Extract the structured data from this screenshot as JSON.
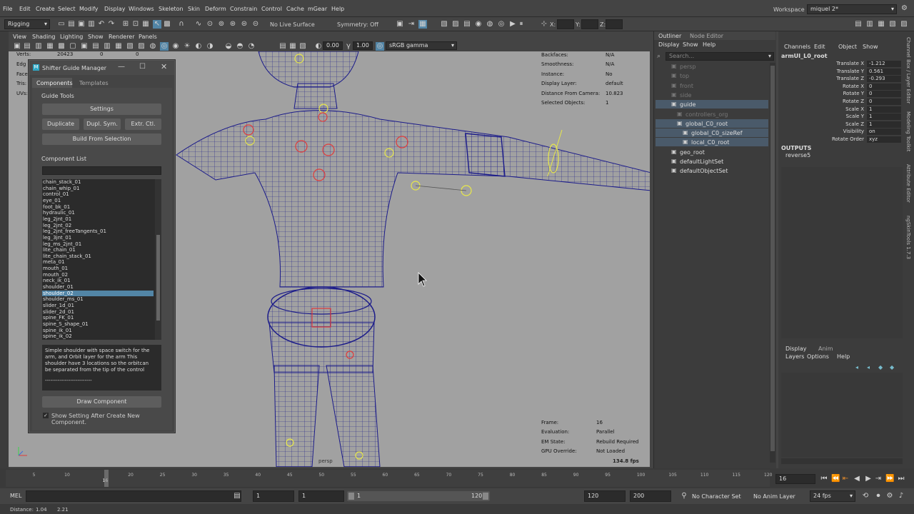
{
  "menubar": {
    "items": [
      "File",
      "Edit",
      "Create",
      "Select",
      "Modify",
      "Display",
      "Windows",
      "Skeleton",
      "Skin",
      "Deform",
      "Constrain",
      "Control",
      "Cache",
      "mGear",
      "Help"
    ],
    "workspace_label": "Workspace :",
    "workspace_value": "miquel 2*"
  },
  "shelf": {
    "mode": "Rigging",
    "live_surface": "No Live Surface",
    "symmetry": "Symmetry: Off",
    "x_label": "X:",
    "y_label": "Y:",
    "z_label": "Z:"
  },
  "viewport_menu": {
    "items": [
      "View",
      "Shading",
      "Lighting",
      "Show",
      "Renderer",
      "Panels"
    ],
    "val1": "0.00",
    "val2": "1.00",
    "colorspace": "sRGB gamma"
  },
  "stats": {
    "verts_label": "Verts:",
    "verts_val": "20423",
    "c2": "0",
    "c3": "0",
    "edges_label": "Edg",
    "faces_label": "Face",
    "tris_label": "Tris:",
    "uvs_label": "UVs:"
  },
  "hud_top": [
    {
      "label": "Backfaces:",
      "value": "N/A"
    },
    {
      "label": "Smoothness:",
      "value": "N/A"
    },
    {
      "label": "Instance:",
      "value": "No"
    },
    {
      "label": "Display Layer:",
      "value": "default"
    },
    {
      "label": "Distance From Camera:",
      "value": "10.823"
    },
    {
      "label": "Selected Objects:",
      "value": "1"
    }
  ],
  "hud_bottom": [
    {
      "label": "Frame:",
      "value": "16"
    },
    {
      "label": "Evaluation:",
      "value": "Parallel"
    },
    {
      "label": "EM State:",
      "value": "Rebuild Required"
    },
    {
      "label": "GPU Override:",
      "value": "Not Loaded"
    }
  ],
  "fps": "134.8 fps",
  "camera": "persp",
  "shifter": {
    "title": "Shifter Guide Manager",
    "tabs": [
      "Components",
      "Templates"
    ],
    "section": "Guide Tools",
    "settings": "Settings",
    "duplicate": "Duplicate",
    "dupl_sym": "Dupl. Sym.",
    "extr_ctl": "Extr. Ctl.",
    "build": "Build From Selection",
    "list_label": "Component List",
    "components": [
      "chain_stack_01",
      "chain_whip_01",
      "control_01",
      "eye_01",
      "foot_bk_01",
      "hydraulic_01",
      "leg_2jnt_01",
      "leg_2jnt_02",
      "leg_2jnt_freeTangents_01",
      "leg_3jnt_01",
      "leg_ms_2jnt_01",
      "lite_chain_01",
      "lite_chain_stack_01",
      "meta_01",
      "mouth_01",
      "mouth_02",
      "neck_ik_01",
      "shoulder_01",
      "shoulder_02",
      "shoulder_ms_01",
      "slider_1d_01",
      "slider_2d_01",
      "spine_FK_01",
      "spine_S_shape_01",
      "spine_ik_01",
      "spine_ik_02"
    ],
    "selected_index": 18,
    "description": "Simple shoulder with space switch for the arm, and Orbit layer for the arm This shoulder have 3 locations so the orbitcan be separated from the tip of the control",
    "desc_sep": "--------------------------",
    "draw": "Draw Component",
    "checkbox": "Show Setting After Create New Component."
  },
  "outliner": {
    "title": "Outliner",
    "node_editor": "Node Editor",
    "menu": [
      "Display",
      "Show",
      "Help"
    ],
    "search_placeholder": "Search...",
    "items": [
      {
        "label": "persp",
        "indent": 0,
        "dim": true
      },
      {
        "label": "top",
        "indent": 0,
        "dim": true
      },
      {
        "label": "front",
        "indent": 0,
        "dim": true
      },
      {
        "label": "side",
        "indent": 0,
        "dim": true
      },
      {
        "label": "guide",
        "indent": 0,
        "dim": false
      },
      {
        "label": "controllers_org",
        "indent": 1,
        "dim": true
      },
      {
        "label": "global_C0_root",
        "indent": 1,
        "dim": false
      },
      {
        "label": "global_C0_sizeRef",
        "indent": 2,
        "dim": false
      },
      {
        "label": "local_C0_root",
        "indent": 2,
        "dim": false
      },
      {
        "label": "geo_root",
        "indent": 0,
        "dim": false
      },
      {
        "label": "defaultLightSet",
        "indent": 0,
        "dim": false
      },
      {
        "label": "defaultObjectSet",
        "indent": 0,
        "dim": false
      }
    ]
  },
  "channels": {
    "menu": [
      "Channels",
      "Edit",
      "Object",
      "Show"
    ],
    "node": "armUI_L0_root",
    "attrs": [
      {
        "label": "Translate X",
        "value": "-1.212"
      },
      {
        "label": "Translate Y",
        "value": "0.561"
      },
      {
        "label": "Translate Z",
        "value": "-0.293"
      },
      {
        "label": "Rotate X",
        "value": "0"
      },
      {
        "label": "Rotate Y",
        "value": "0"
      },
      {
        "label": "Rotate Z",
        "value": "0"
      },
      {
        "label": "Scale X",
        "value": "1"
      },
      {
        "label": "Scale Y",
        "value": "1"
      },
      {
        "label": "Scale Z",
        "value": "1"
      },
      {
        "label": "Visibility",
        "value": "on"
      },
      {
        "label": "Rotate Order",
        "value": "xyz"
      }
    ],
    "outputs_label": "OUTPUTS",
    "output": "reverse5",
    "layer_tabs": [
      "Display",
      "Anim"
    ],
    "layer_menu": [
      "Layers",
      "Options",
      "Help"
    ]
  },
  "right_tabs": [
    "Channel Box / Layer Editor",
    "Modeling Toolkit",
    "Attribute Editor",
    "ngSkinTools 1.7.3"
  ],
  "timeline": {
    "ticks": [
      "5",
      "10",
      "16",
      "20",
      "25",
      "30",
      "35",
      "40",
      "45",
      "50",
      "55",
      "60",
      "65",
      "70",
      "75",
      "80",
      "85",
      "90",
      "95",
      "100",
      "105",
      "110",
      "115",
      "120"
    ],
    "current": "16",
    "current_field": "16"
  },
  "range": {
    "mel": "MEL",
    "start": "1",
    "start2": "1",
    "slider_start": "1",
    "slider_end": "120",
    "end": "120",
    "end2": "200",
    "char_set": "No Character Set",
    "anim_layer": "No Anim Layer",
    "fps": "24 fps"
  },
  "helpline": {
    "label": "Distance:",
    "v1": "1.04",
    "v2": "2.21"
  }
}
